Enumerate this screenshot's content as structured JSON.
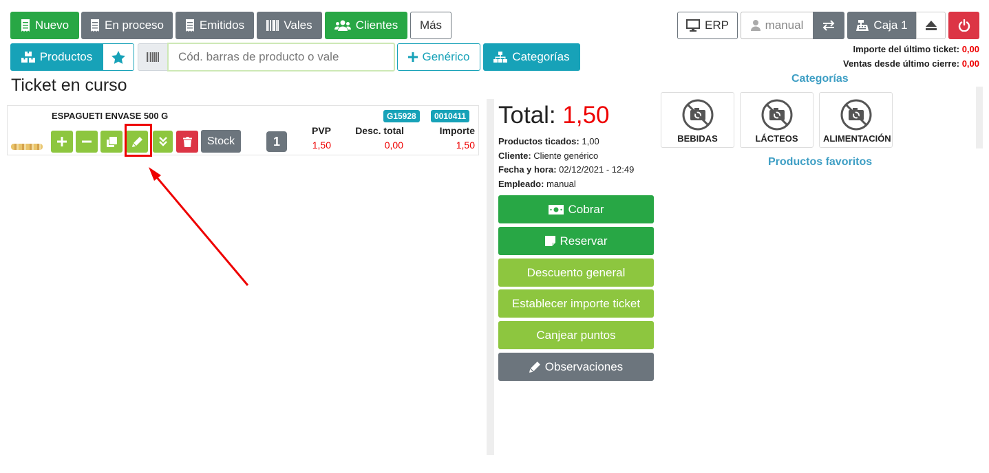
{
  "topbar": {
    "nuevo": "Nuevo",
    "en_proceso": "En proceso",
    "emitidos": "Emitidos",
    "vales": "Vales",
    "clientes": "Clientes",
    "mas": "Más",
    "erp": "ERP",
    "user": "manual",
    "caja": "Caja 1"
  },
  "status": {
    "last_ticket_label": "Importe del último ticket:",
    "last_ticket_value": "0,00",
    "sales_label": "Ventas desde último cierre:",
    "sales_value": "0,00"
  },
  "toolbar": {
    "productos": "Productos",
    "barcode_placeholder": "Cód. barras de producto o vale",
    "generico": "Genérico",
    "categorias": "Categorías"
  },
  "page_title": "Ticket en curso",
  "line": {
    "name": "ESPAGUETI ENVASE 500 G",
    "tag1": "G15928",
    "tag2": "0010411",
    "stock": "Stock",
    "qty": "1",
    "pvp_h": "PVP",
    "pvp": "1,50",
    "desc_h": "Desc. total",
    "desc": "0,00",
    "imp_h": "Importe",
    "imp": "1,50"
  },
  "summary": {
    "total_label": "Total:",
    "total": "1,50",
    "productos_label": "Productos ticados:",
    "productos": "1,00",
    "cliente_label": "Cliente:",
    "cliente": "Cliente genérico",
    "fecha_label": "Fecha y hora:",
    "fecha": "02/12/2021 - 12:49",
    "empleado_label": "Empleado:",
    "empleado": "manual"
  },
  "actions": {
    "cobrar": "Cobrar",
    "reservar": "Reservar",
    "descuento": "Descuento general",
    "establecer": "Establecer importe ticket",
    "canjear": "Canjear puntos",
    "observaciones": "Observaciones"
  },
  "right": {
    "categorias_title": "Categorías",
    "categories": [
      "BEBIDAS",
      "LÁCTEOS",
      "ALIMENTACIÓN"
    ],
    "favoritos_title": "Productos favoritos"
  },
  "colors": {
    "green": "#28a745",
    "lime": "#8dc63f",
    "teal": "#17a2b8",
    "gray": "#6c757d",
    "red": "#dc3545",
    "price_red": "#e00"
  }
}
